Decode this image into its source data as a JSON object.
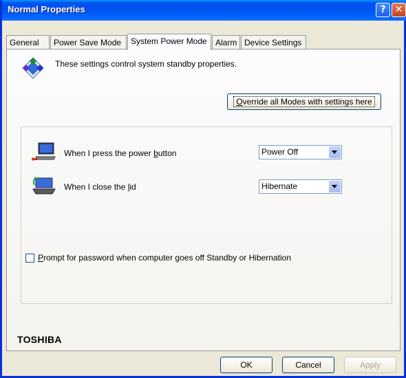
{
  "window": {
    "title": "Normal Properties",
    "help_glyph": "?",
    "close_glyph": "✕"
  },
  "tabs": [
    {
      "label": "General"
    },
    {
      "label": "Power Save Mode"
    },
    {
      "label": "System Power Mode",
      "active": true
    },
    {
      "label": "Alarm"
    },
    {
      "label": "Device Settings"
    }
  ],
  "intro": {
    "text": "These settings control system standby properties.",
    "icon": "standby-diamond-icon"
  },
  "override_button": {
    "prefix": "",
    "mnemonic": "O",
    "rest": "verride all Modes with settings here"
  },
  "rows": {
    "power": {
      "label_pre": "When I press the power ",
      "mnemonic": "b",
      "label_post": "utton",
      "value": "Power Off",
      "icon": "laptop-power-icon"
    },
    "lid": {
      "label_pre": "When I close the ",
      "mnemonic": "l",
      "label_post": "id",
      "value": "Hibernate",
      "icon": "laptop-lid-icon"
    }
  },
  "password_prompt": {
    "mnemonic": "P",
    "rest": "rompt for password when computer goes off Standby or Hibernation",
    "checked": false
  },
  "brand": "TOSHIBA",
  "footer": {
    "ok": "OK",
    "cancel": "Cancel",
    "apply": "Apply"
  },
  "colors": {
    "title_bar": "#0053ee",
    "dialog_bg": "#ece9d8",
    "border": "#0831d9"
  }
}
